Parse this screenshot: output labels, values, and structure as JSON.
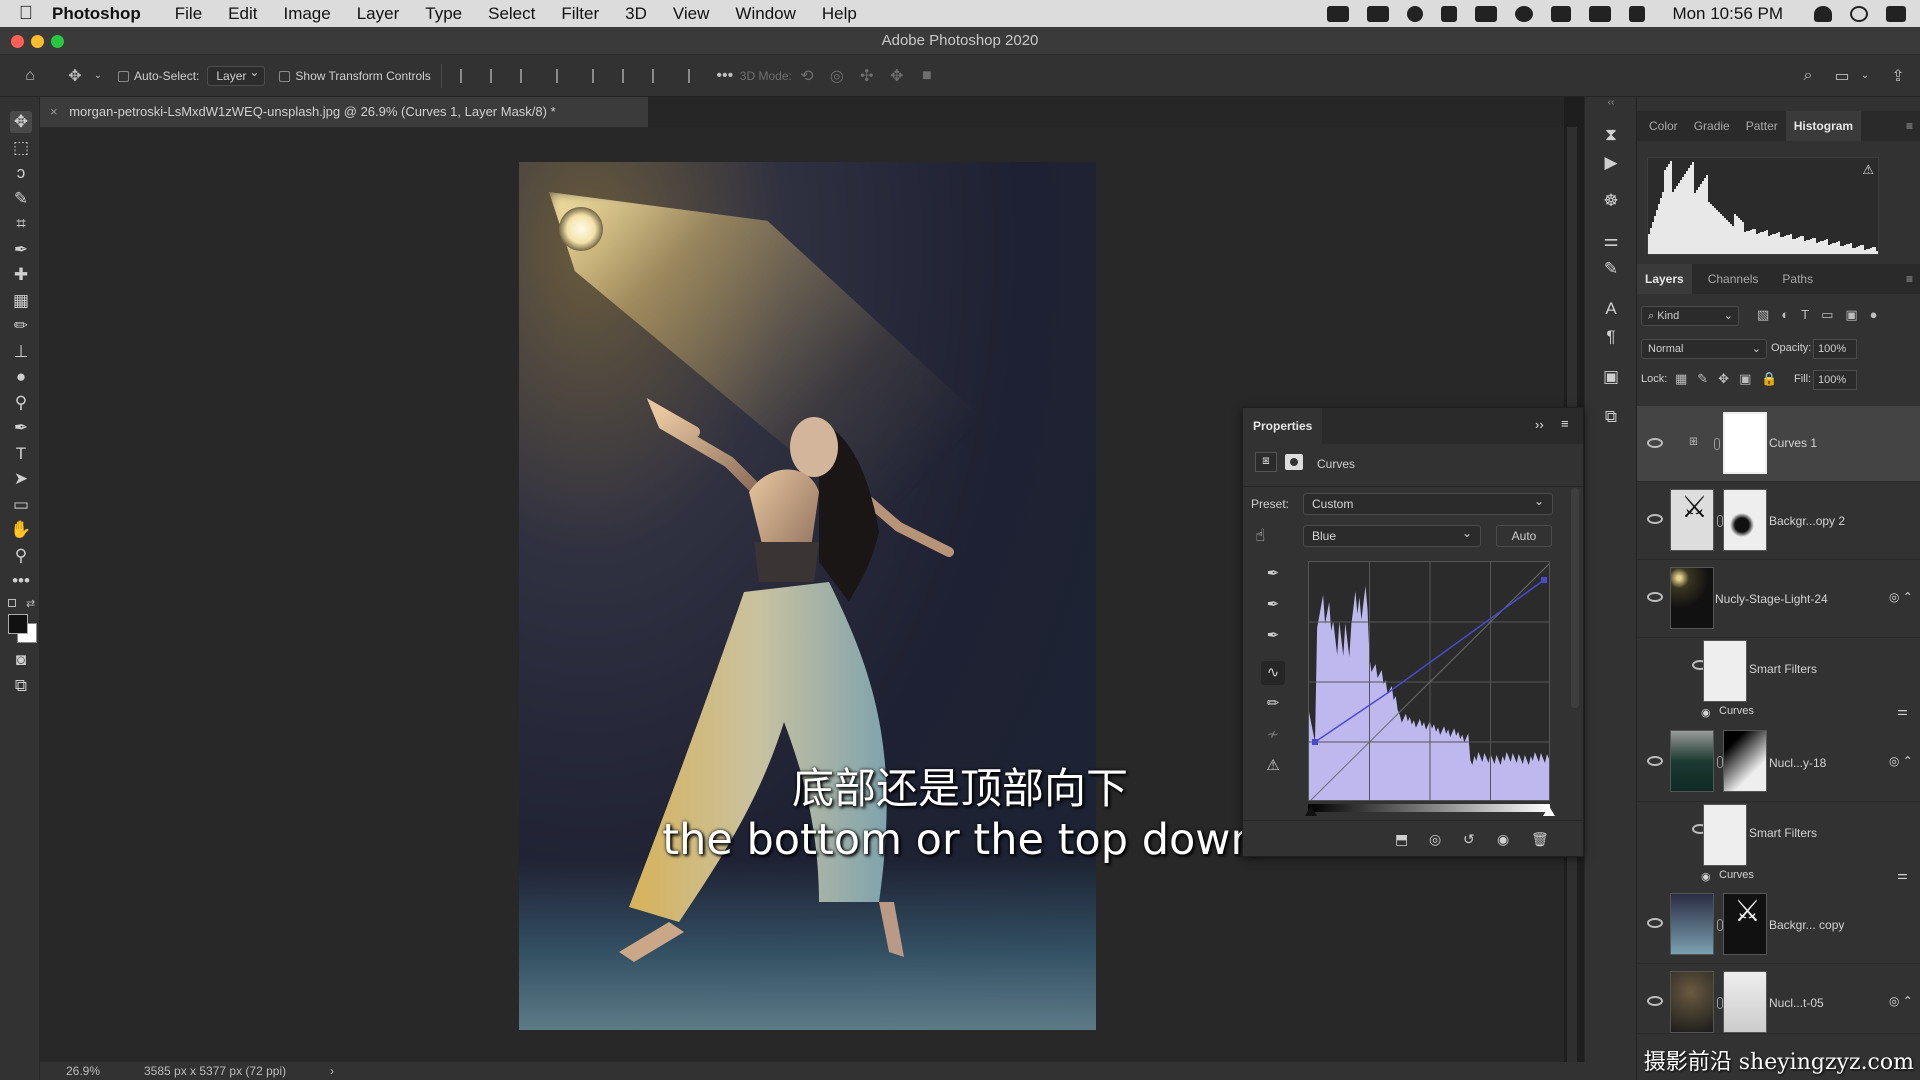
{
  "menubar": {
    "app_name": "Photoshop",
    "items": [
      "File",
      "Edit",
      "Image",
      "Layer",
      "Type",
      "Select",
      "Filter",
      "3D",
      "View",
      "Window",
      "Help"
    ],
    "clock": "Mon 10:56 PM"
  },
  "window": {
    "title": "Adobe Photoshop 2020"
  },
  "options_bar": {
    "auto_select_label": "Auto-Select:",
    "auto_select_value": "Layer",
    "show_transform_label": "Show Transform Controls",
    "mode_3d_label": "3D Mode:"
  },
  "document": {
    "tab_title": "morgan-petroski-LsMxdW1zWEQ-unsplash.jpg @ 26.9% (Curves 1, Layer Mask/8) *",
    "close_glyph": "×"
  },
  "status_bar": {
    "zoom": "26.9%",
    "doc_info": "3585 px x 5377 px (72 ppi)",
    "arrow": "›"
  },
  "top_panel": {
    "tabs": [
      "Color",
      "Gradie",
      "Patter",
      "Histogram"
    ],
    "active_tab": "Histogram"
  },
  "layers_panel": {
    "tabs": [
      "Layers",
      "Channels",
      "Paths"
    ],
    "active_tab": "Layers",
    "filter_label": "Kind",
    "blend_mode": "Normal",
    "opacity_label": "Opacity:",
    "opacity_value": "100%",
    "lock_label": "Lock:",
    "fill_label": "Fill:",
    "fill_value": "100%",
    "layers": [
      {
        "name": "Curves 1"
      },
      {
        "name": "Backgr...opy 2"
      },
      {
        "name": "Nucly-Stage-Light-24"
      },
      {
        "name": "Smart Filters"
      },
      {
        "name": "Curves"
      },
      {
        "name": "Nucl...y-18"
      },
      {
        "name": "Smart Filters"
      },
      {
        "name": "Curves"
      },
      {
        "name": "Backgr... copy"
      },
      {
        "name": "Nucl...t-05"
      }
    ]
  },
  "properties_panel": {
    "title": "Properties",
    "type_label": "Curves",
    "preset_label": "Preset:",
    "preset_value": "Custom",
    "channel_value": "Blue",
    "auto_label": "Auto"
  },
  "subtitles": {
    "chinese": "底部还是顶部向下",
    "english": "the bottom or the top down"
  },
  "watermark": "摄影前沿 sheyingzyz.com",
  "colors": {
    "accent_blue_curve": "#4a4ad0",
    "histogram_fill": "#bfb8ef"
  },
  "icons": [
    "apple-icon",
    "home-icon",
    "move-icon",
    "search-icon",
    "workspace-icon",
    "share-icon",
    "eye-icon",
    "lock-icon"
  ]
}
